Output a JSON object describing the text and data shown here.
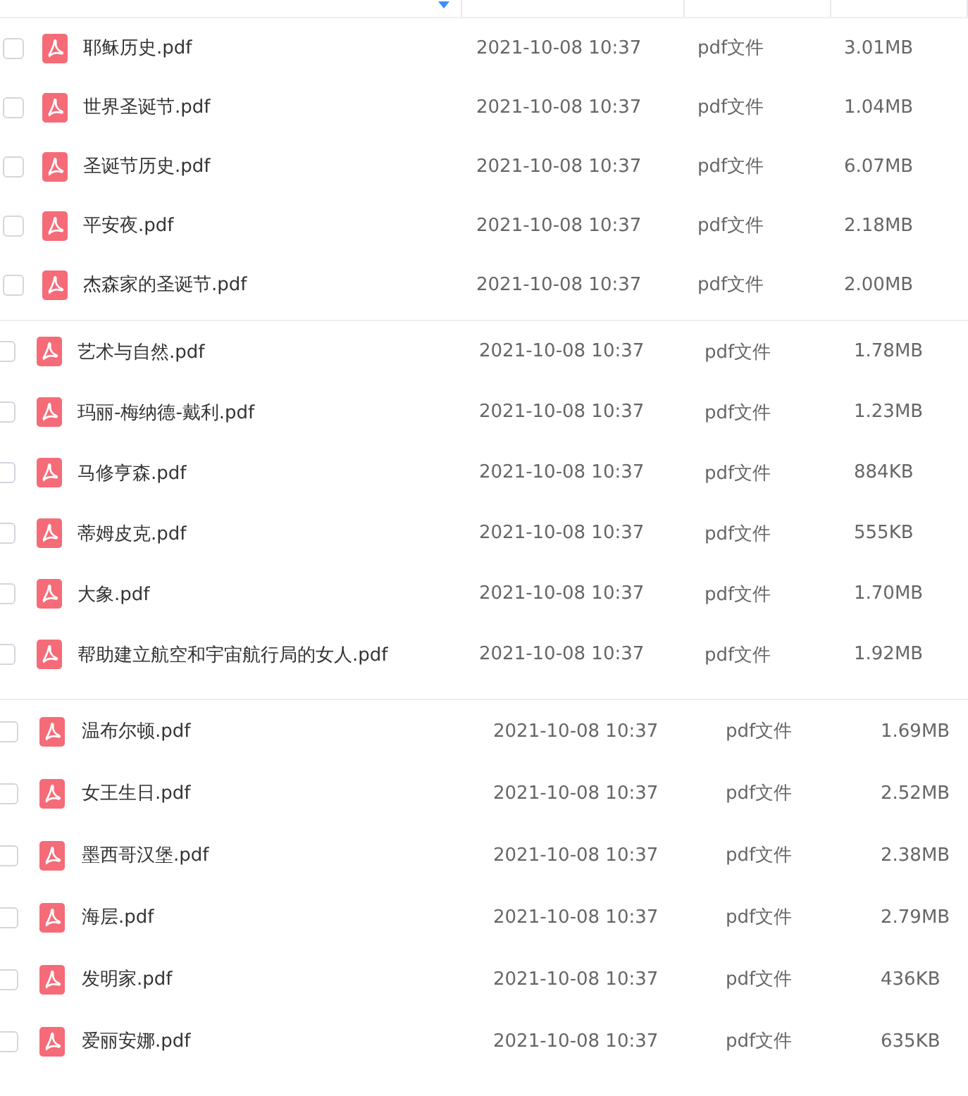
{
  "sections": [
    {
      "rows": [
        {
          "name": "耶稣历史.pdf",
          "modified": "2021-10-08 10:37",
          "type": "pdf文件",
          "size": "3.01MB",
          "checked": false
        },
        {
          "name": "世界圣诞节.pdf",
          "modified": "2021-10-08 10:37",
          "type": "pdf文件",
          "size": "1.04MB",
          "checked": false
        },
        {
          "name": "圣诞节历史.pdf",
          "modified": "2021-10-08 10:37",
          "type": "pdf文件",
          "size": "6.07MB",
          "checked": false
        },
        {
          "name": "平安夜.pdf",
          "modified": "2021-10-08 10:37",
          "type": "pdf文件",
          "size": "2.18MB",
          "checked": false
        },
        {
          "name": "杰森家的圣诞节.pdf",
          "modified": "2021-10-08 10:37",
          "type": "pdf文件",
          "size": "2.00MB",
          "checked": false
        }
      ]
    },
    {
      "rows": [
        {
          "name": "艺术与自然.pdf",
          "modified": "2021-10-08 10:37",
          "type": "pdf文件",
          "size": "1.78MB",
          "checked": false
        },
        {
          "name": "玛丽-梅纳德-戴利.pdf",
          "modified": "2021-10-08 10:37",
          "type": "pdf文件",
          "size": "1.23MB",
          "checked": false
        },
        {
          "name": "马修亨森.pdf",
          "modified": "2021-10-08 10:37",
          "type": "pdf文件",
          "size": "884KB",
          "checked": false
        },
        {
          "name": "蒂姆皮克.pdf",
          "modified": "2021-10-08 10:37",
          "type": "pdf文件",
          "size": "555KB",
          "checked": false
        },
        {
          "name": "大象.pdf",
          "modified": "2021-10-08 10:37",
          "type": "pdf文件",
          "size": "1.70MB",
          "checked": false
        },
        {
          "name": "帮助建立航空和宇宙航行局的女人.pdf",
          "modified": "2021-10-08 10:37",
          "type": "pdf文件",
          "size": "1.92MB",
          "checked": false
        }
      ]
    },
    {
      "rows": [
        {
          "name": "温布尔顿.pdf",
          "modified": "2021-10-08 10:37",
          "type": "pdf文件",
          "size": "1.69MB",
          "checked": false
        },
        {
          "name": "女王生日.pdf",
          "modified": "2021-10-08 10:37",
          "type": "pdf文件",
          "size": "2.52MB",
          "checked": false
        },
        {
          "name": "墨西哥汉堡.pdf",
          "modified": "2021-10-08 10:37",
          "type": "pdf文件",
          "size": "2.38MB",
          "checked": false
        },
        {
          "name": "海层.pdf",
          "modified": "2021-10-08 10:37",
          "type": "pdf文件",
          "size": "2.79MB",
          "checked": false
        },
        {
          "name": "发明家.pdf",
          "modified": "2021-10-08 10:37",
          "type": "pdf文件",
          "size": "436KB",
          "checked": false
        },
        {
          "name": "爱丽安娜.pdf",
          "modified": "2021-10-08 10:37",
          "type": "pdf文件",
          "size": "635KB",
          "checked": false
        }
      ]
    }
  ]
}
